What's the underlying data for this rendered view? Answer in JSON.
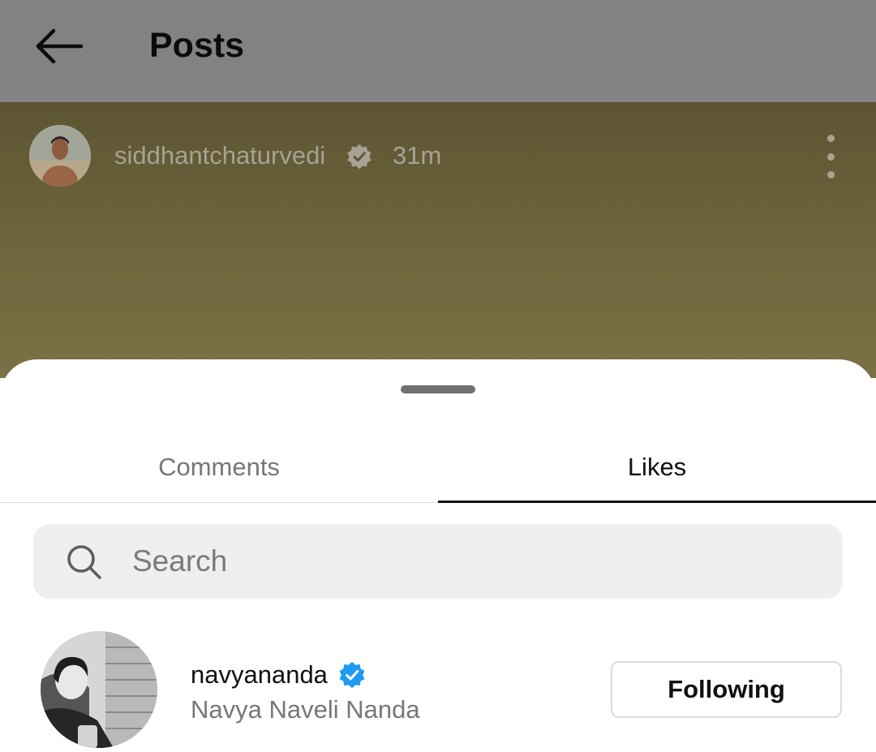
{
  "header": {
    "title": "Posts",
    "back_icon": "arrow-left-icon"
  },
  "post": {
    "author": "siddhantchaturvedi",
    "verified": true,
    "time": "31m",
    "more_icon": "more-vertical-icon",
    "background_colors": [
      "#5d5433",
      "#7b7045"
    ]
  },
  "sheet": {
    "tabs": [
      {
        "label": "Comments",
        "active": false
      },
      {
        "label": "Likes",
        "active": true
      }
    ],
    "search": {
      "placeholder": "Search",
      "value": "",
      "icon": "search-icon"
    },
    "likes": [
      {
        "username": "navyananda",
        "full_name": "Navya Naveli Nanda",
        "verified": true,
        "button_label": "Following"
      }
    ]
  },
  "colors": {
    "verified_blue": "#1d9bf0",
    "topbar_overlay": "#828282",
    "tab_indicator": "#0c0c0c"
  }
}
